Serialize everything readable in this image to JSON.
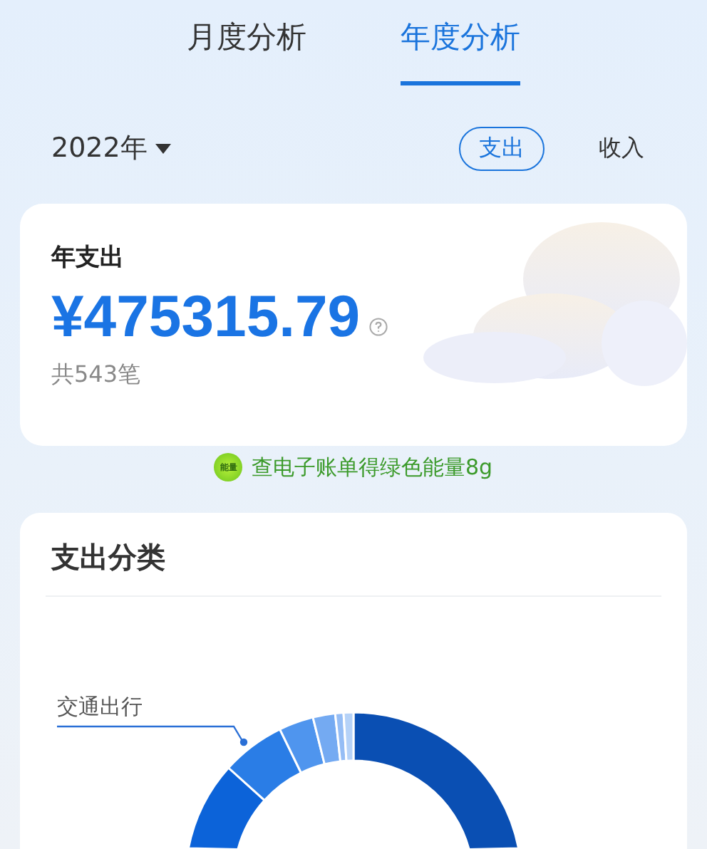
{
  "tabs": [
    {
      "label": "月度分析",
      "selected": false
    },
    {
      "label": "年度分析",
      "selected": true
    }
  ],
  "year_picker": {
    "label": "2022年"
  },
  "type_toggle": [
    {
      "label": "支出",
      "selected": true
    },
    {
      "label": "收入",
      "selected": false
    }
  ],
  "summary_card": {
    "title": "年支出",
    "amount": "¥475315.79",
    "count": "共543笔"
  },
  "promo": {
    "badge": "能量",
    "text": "查电子账单得绿色能量8g"
  },
  "category_card": {
    "title": "支出分类",
    "callout_label": "交通出行"
  }
}
